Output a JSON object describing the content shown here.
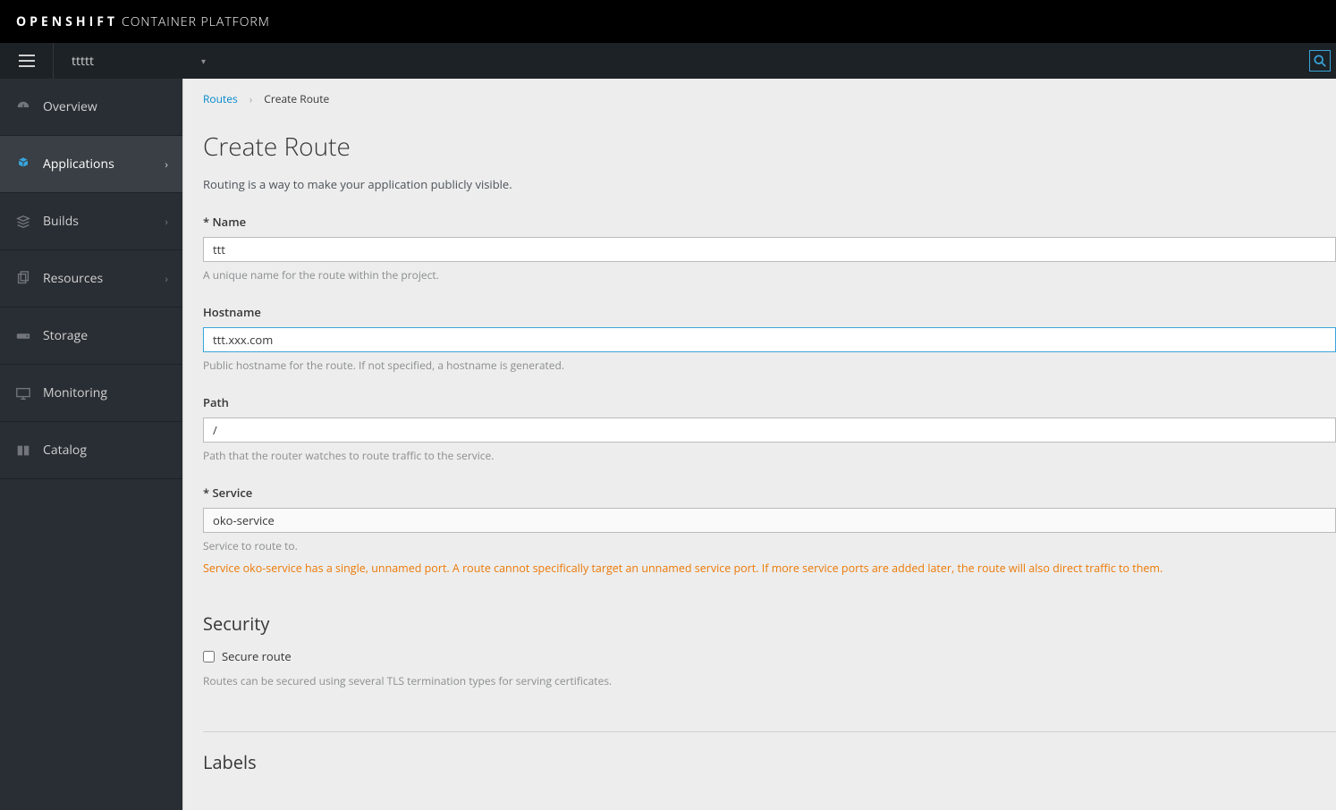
{
  "brand": {
    "strong": "OPENSHIFT",
    "light": "CONTAINER PLATFORM"
  },
  "navbar": {
    "project": "ttttt"
  },
  "sidebar": {
    "items": [
      {
        "label": "Overview"
      },
      {
        "label": "Applications"
      },
      {
        "label": "Builds"
      },
      {
        "label": "Resources"
      },
      {
        "label": "Storage"
      },
      {
        "label": "Monitoring"
      },
      {
        "label": "Catalog"
      }
    ]
  },
  "breadcrumb": {
    "parent": "Routes",
    "current": "Create Route"
  },
  "page": {
    "title": "Create Route",
    "lead": "Routing is a way to make your application publicly visible."
  },
  "form": {
    "name": {
      "label": "Name",
      "value": "ttt",
      "help": "A unique name for the route within the project."
    },
    "hostname": {
      "label": "Hostname",
      "value": "ttt.xxx.com",
      "help": "Public hostname for the route. If not specified, a hostname is generated."
    },
    "path": {
      "label": "Path",
      "value": "/",
      "help": "Path that the router watches to route traffic to the service."
    },
    "service": {
      "label": "Service",
      "value": "oko-service",
      "help": "Service to route to.",
      "warn": "Service oko-service has a single, unnamed port. A route cannot specifically target an unnamed service port. If more service ports are added later, the route will also direct traffic to them."
    },
    "security": {
      "heading": "Security",
      "checkbox": "Secure route",
      "help": "Routes can be secured using several TLS termination types for serving certificates."
    },
    "labels": {
      "heading": "Labels"
    }
  }
}
